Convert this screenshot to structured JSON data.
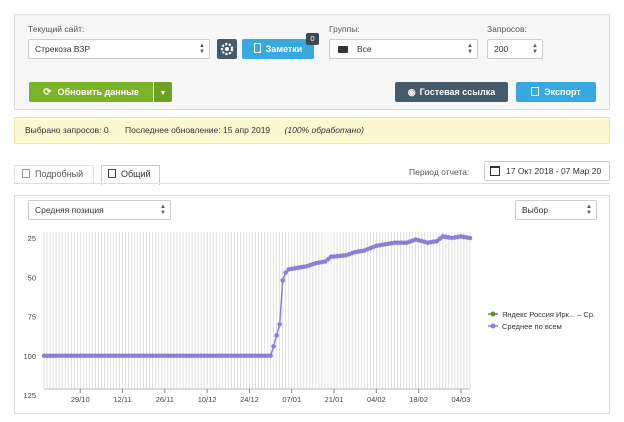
{
  "filters": {
    "site_label": "Текущий сайт:",
    "site_value": "Стрекоза ВЗР",
    "notes_label": "Заметки",
    "notes_badge": "0",
    "groups_label": "Группы:",
    "groups_value": "Все",
    "requests_label": "Запросов:",
    "requests_value": "200"
  },
  "actions": {
    "refresh_label": "Обновить данные",
    "guest_link_label": "Гостевая ссылка",
    "export_label": "Экспорт"
  },
  "info": {
    "selected_label": "Выбрано запросов:",
    "selected_value": "0",
    "updated_label": "Последнее обновление:",
    "updated_value": "15 апр 2019",
    "processed": "(100% обработано)"
  },
  "tabs": {
    "detailed": "Подробный",
    "general": "Общий"
  },
  "period": {
    "label": "Период отчета:",
    "value": "17 Окт 2018 - 07 Мар 20"
  },
  "chart_controls": {
    "metric_value": "Средняя позиция",
    "choice_value": "Выбор"
  },
  "colors": {
    "green": "#7cb428",
    "blue": "#38a8e0",
    "dark": "#455a6a",
    "series_avg": "#8b7fd6",
    "series_yandex": "#6b8e23",
    "info_bg": "#fcf8d0"
  },
  "chart_data": {
    "type": "line",
    "y_inverted": true,
    "ylim": [
      25,
      125
    ],
    "yticks": [
      25,
      50,
      75,
      100,
      125
    ],
    "x_range": [
      "2018-10-17",
      "2019-03-07"
    ],
    "xtick_labels": [
      "29/10",
      "12/11",
      "26/11",
      "10/12",
      "24/12",
      "07/01",
      "21/01",
      "04/02",
      "18/02",
      "04/03"
    ],
    "xticks": [
      "2018-10-29",
      "2018-11-12",
      "2018-11-26",
      "2018-12-10",
      "2018-12-24",
      "2019-01-07",
      "2019-01-21",
      "2019-02-04",
      "2019-02-18",
      "2019-03-04"
    ],
    "legend_position": "right",
    "series": [
      {
        "name": "Яндекс Россия Ирк... – Ср.",
        "points": []
      },
      {
        "name": "Среднее по всем",
        "points": [
          [
            "2018-10-17",
            100
          ],
          [
            "2018-12-31",
            100
          ],
          [
            "2019-01-01",
            94
          ],
          [
            "2019-01-02",
            87
          ],
          [
            "2019-01-03",
            80
          ],
          [
            "2019-01-04",
            52
          ],
          [
            "2019-01-05",
            47
          ],
          [
            "2019-01-06",
            45
          ],
          [
            "2019-01-09",
            44
          ],
          [
            "2019-01-12",
            43
          ],
          [
            "2019-01-15",
            41
          ],
          [
            "2019-01-18",
            40
          ],
          [
            "2019-01-20",
            37
          ],
          [
            "2019-01-25",
            36
          ],
          [
            "2019-01-28",
            34
          ],
          [
            "2019-01-31",
            33
          ],
          [
            "2019-02-04",
            30
          ],
          [
            "2019-02-07",
            29
          ],
          [
            "2019-02-10",
            28
          ],
          [
            "2019-02-14",
            28
          ],
          [
            "2019-02-17",
            26
          ],
          [
            "2019-02-21",
            28
          ],
          [
            "2019-02-24",
            27
          ],
          [
            "2019-02-26",
            24
          ],
          [
            "2019-03-01",
            25
          ],
          [
            "2019-03-04",
            24
          ],
          [
            "2019-03-07",
            25
          ]
        ]
      }
    ]
  }
}
